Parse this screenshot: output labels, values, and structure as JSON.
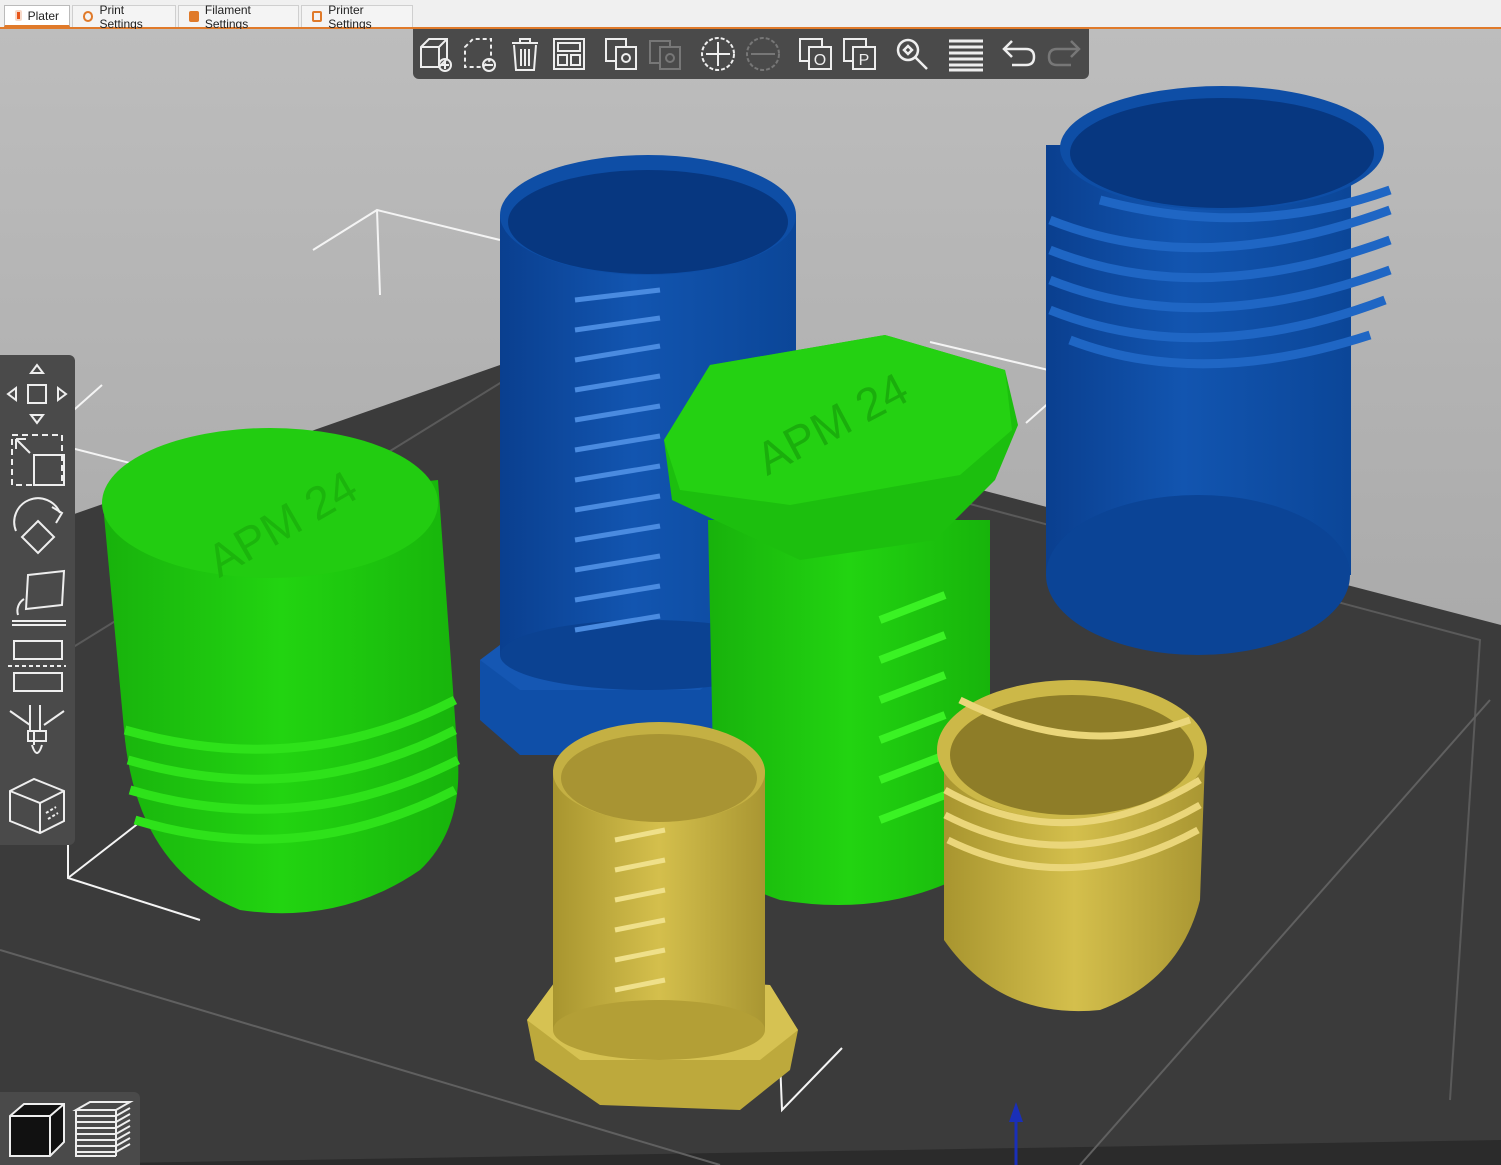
{
  "tabs": [
    {
      "label": "Plater",
      "icon": "plater-icon",
      "color": "#e8561a",
      "active": true
    },
    {
      "label": "Print Settings",
      "icon": "print-settings-icon",
      "color": "#e07a2a"
    },
    {
      "label": "Filament Settings",
      "icon": "filament-settings-icon",
      "color": "#e07a2a"
    },
    {
      "label": "Printer Settings",
      "icon": "printer-settings-icon",
      "color": "#e07a2a"
    }
  ],
  "toolbar": {
    "items": [
      "add-object-icon",
      "delete-object-icon",
      "delete-all-icon",
      "arrange-icon",
      "copy-icon",
      "paste-icon",
      "add-instance-icon",
      "remove-instance-icon",
      "split-objects-icon",
      "split-parts-icon",
      "search-icon",
      "layers-editing-icon",
      "undo-icon",
      "redo-icon"
    ]
  },
  "left_toolbar": {
    "items": [
      "move-icon",
      "scale-icon",
      "rotate-icon",
      "place-on-face-icon",
      "cut-icon",
      "paint-supports-icon",
      "sla-support-icon"
    ]
  },
  "view_mode": {
    "items": [
      "3d-view-icon",
      "preview-layers-icon"
    ]
  },
  "models": [
    {
      "shape": "tall-cylinder-cup",
      "color": "#0f4fa8"
    },
    {
      "shape": "threaded-cup",
      "color": "#0f4fa8"
    },
    {
      "shape": "round-cap",
      "color": "#1fcc0e",
      "engraving": "APM 24"
    },
    {
      "shape": "hex-bolt",
      "color": "#1fcc0e",
      "engraving": "APM 24"
    },
    {
      "shape": "hex-nut-cup",
      "color": "#c9b440"
    },
    {
      "shape": "threaded-ring",
      "color": "#c9b440"
    }
  ],
  "colors": {
    "bed": "#3c3c3c",
    "background": "#a9a9a9",
    "accent": "#e07a2a",
    "blue": "#0f4fa8",
    "green": "#1fcc0e",
    "gold": "#c9b440"
  }
}
